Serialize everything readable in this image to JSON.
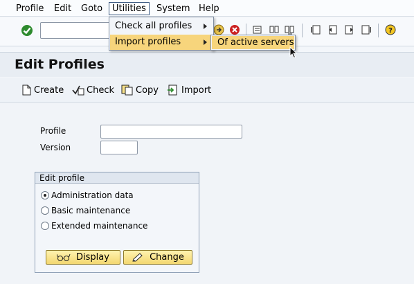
{
  "menubar": {
    "items": [
      "Profile",
      "Edit",
      "Goto",
      "Utilities",
      "System",
      "Help"
    ]
  },
  "utilities_menu": {
    "items": [
      {
        "label": "Check all profiles",
        "has_submenu": true
      },
      {
        "label": "Import profiles",
        "has_submenu": true,
        "highlighted": true
      }
    ]
  },
  "import_submenu": {
    "items": [
      "Of active servers"
    ]
  },
  "page": {
    "title": "Edit Profiles"
  },
  "app_toolbar": {
    "create": "Create",
    "check": "Check",
    "copy": "Copy",
    "import": "Import"
  },
  "form": {
    "profile_label": "Profile",
    "profile_value": "",
    "version_label": "Version",
    "version_value": ""
  },
  "edit_profile": {
    "group_title": "Edit profile",
    "options": [
      "Administration data",
      "Basic maintenance",
      "Extended maintenance"
    ],
    "selected": "Administration data",
    "display_label": "Display",
    "change_label": "Change"
  },
  "colors": {
    "highlight": "#f7d57c",
    "ok_green": "#2e8b2e",
    "cancel_red": "#cc2222"
  }
}
